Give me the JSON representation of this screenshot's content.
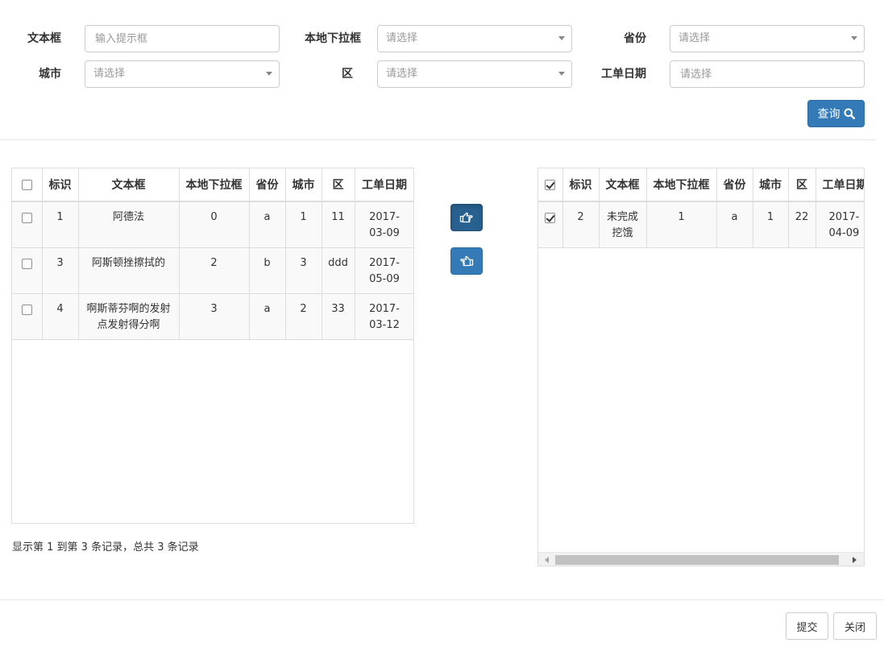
{
  "filters": {
    "text_box": {
      "label": "文本框",
      "placeholder": "输入提示框"
    },
    "local_dropdown": {
      "label": "本地下拉框",
      "placeholder": "请选择"
    },
    "province": {
      "label": "省份",
      "placeholder": "请选择"
    },
    "city": {
      "label": "城市",
      "placeholder": "请选择"
    },
    "district": {
      "label": "区",
      "placeholder": "请选择"
    },
    "work_date": {
      "label": "工单日期",
      "placeholder": "请选择"
    }
  },
  "query_button": {
    "label": "查询"
  },
  "columns": [
    "标识",
    "文本框",
    "本地下拉框",
    "省份",
    "城市",
    "区",
    "工单日期"
  ],
  "left_table": {
    "rows": [
      {
        "id": "1",
        "text": "阿德法",
        "local": "0",
        "province": "a",
        "city": "1",
        "district": "11",
        "date": "2017-\n03-09"
      },
      {
        "id": "3",
        "text": "阿斯顿挫擦拭的",
        "local": "2",
        "province": "b",
        "city": "3",
        "district": "ddd",
        "date": "2017-\n05-09"
      },
      {
        "id": "4",
        "text": "啊斯蒂芬啊的发射点发射得分啊",
        "local": "3",
        "province": "a",
        "city": "2",
        "district": "33",
        "date": "2017-\n03-12"
      }
    ],
    "pagination": "显示第 1 到第 3 条记录，总共 3 条记录"
  },
  "right_table": {
    "header_checked": true,
    "rows": [
      {
        "checked": true,
        "id": "2",
        "text": "未完成挖饿",
        "local": "1",
        "province": "a",
        "city": "1",
        "district": "22",
        "date": "2017-\n04-09"
      }
    ]
  },
  "transfer_buttons": {
    "move_right_icon": "hand-point-right-icon",
    "move_left_icon": "hand-point-left-icon"
  },
  "footer": {
    "submit_label": "提交",
    "close_label": "关闭"
  },
  "colors": {
    "primary": "#337ab7",
    "primary_dark": "#286090",
    "border": "#dddddd",
    "stripe": "#f9f9f9"
  }
}
